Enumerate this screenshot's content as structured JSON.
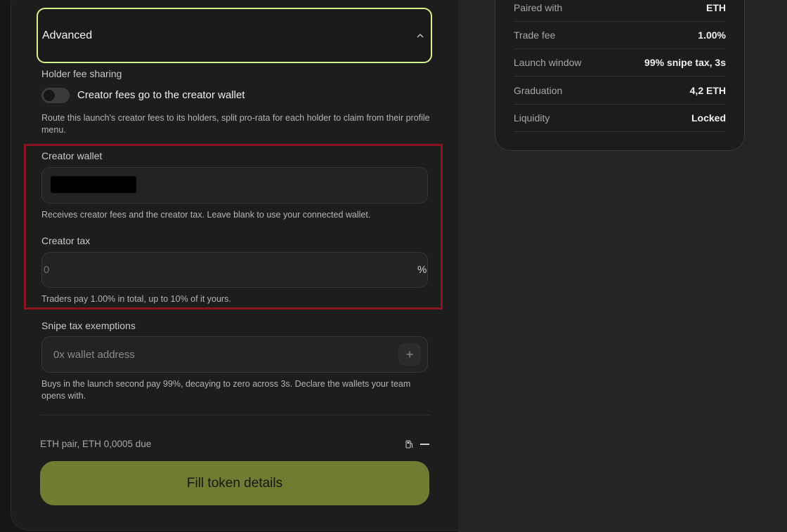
{
  "summary": {
    "rows": [
      {
        "label": "Paired with",
        "value": "ETH"
      },
      {
        "label": "Trade fee",
        "value": "1.00%"
      },
      {
        "label": "Launch window",
        "value": "99% snipe tax, 3s"
      },
      {
        "label": "Graduation",
        "value": "4,2 ETH"
      },
      {
        "label": "Liquidity",
        "value": "Locked"
      }
    ]
  },
  "advanced": {
    "title": "Advanced",
    "icon": "chevron-up-icon"
  },
  "holder_fee": {
    "label": "Holder fee sharing",
    "toggle_label": "Creator fees go to the creator wallet",
    "toggle_on": false,
    "help": "Route this launch's creator fees to its holders, split pro-rata for each holder to claim from their profile menu."
  },
  "creator_wallet": {
    "label": "Creator wallet",
    "value": "",
    "help": "Receives creator fees and the creator tax. Leave blank to use your connected wallet."
  },
  "creator_tax": {
    "label": "Creator tax",
    "placeholder": "0",
    "suffix": "%",
    "help": "Traders pay 1.00% in total, up to 10% of it yours."
  },
  "snipe": {
    "label": "Snipe tax exemptions",
    "placeholder": "0x wallet address",
    "add_symbol": "+",
    "help": "Buys in the launch second pay 99%, decaying to zero across 3s. Declare the wallets your team opens with."
  },
  "footer": {
    "text": "ETH pair, ETH 0,0005 due",
    "gas_icon": "gas-pump-icon"
  },
  "cta": {
    "label": "Fill token details"
  },
  "colors": {
    "accent_border": "#d6f08a",
    "cta_bg": "#6e7d31",
    "highlight_border": "#8a1420"
  }
}
